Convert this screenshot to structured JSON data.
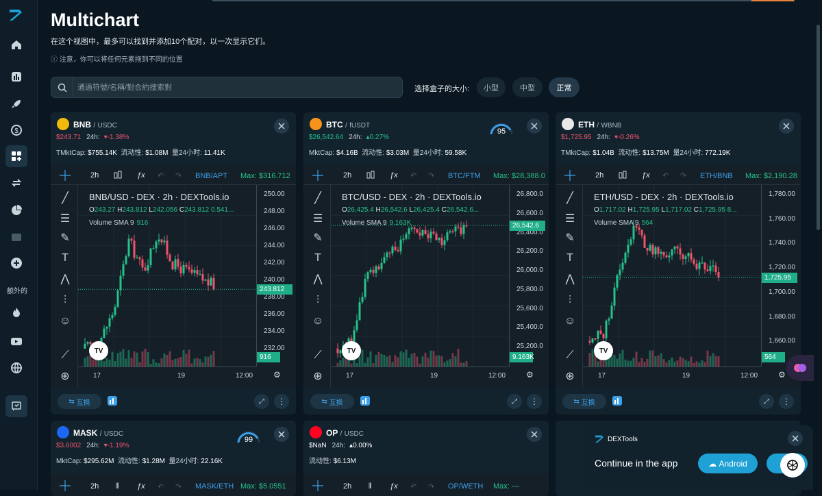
{
  "page": {
    "title": "Multichart",
    "subtitle": "在这个视图中，最多可以找到并添加10个配对，以一次显示它们。",
    "note": "注意，你可以将任何元素拖到不同的位置"
  },
  "sidebar": {
    "extra_label": "额外的",
    "items": [
      "home-icon",
      "chart-icon",
      "rocket-icon",
      "dollar-icon",
      "multichart-icon",
      "swap-icon",
      "pie-icon",
      "wallet-icon",
      "plus-icon",
      "fire-icon",
      "youtube-icon",
      "globe-icon",
      "feedback-icon"
    ]
  },
  "search": {
    "placeholder": "通過符號/名稱/對合約搜索對"
  },
  "size": {
    "label": "选择盒子的大小:",
    "options": [
      "小型",
      "中型",
      "正常"
    ],
    "selected": "正常"
  },
  "colors": {
    "up": "#25c28a",
    "down": "#f0546c",
    "accent": "#3da0e8",
    "bg": "#0b1720"
  },
  "common": {
    "interval": "2h",
    "swap_label": "互换",
    "x_ticks": [
      "17",
      "19",
      "12:00"
    ],
    "vol_label": "Volume SMA 9"
  },
  "panels": [
    {
      "sym": "BNB",
      "quote": "USDC",
      "price": "$243.71",
      "lbl24": "24h:",
      "change": "-1.38%",
      "dir": "down",
      "stats": [
        [
          "TMktCap:",
          "$755.14K"
        ],
        [
          "流动性:",
          "$1.08M"
        ],
        [
          "量24小时:",
          "11.41K"
        ]
      ],
      "pair_tag": "BNB/APT",
      "max": "Max: $316.712",
      "tv_title": "BNB/USD - DEX · 2h · DEXTools.io",
      "ohlc": {
        "o": "243.27",
        "h": "243.812",
        "l": "242.056",
        "c": "243.812 0.541..."
      },
      "vol": "916",
      "axis_ticks": [
        "250.00",
        "248.00",
        "246.00",
        "244.00",
        "242.00",
        "240.00",
        "238.00",
        "236.00",
        "234.00",
        "232.00"
      ],
      "price_tag": "243.812",
      "vol_tag": "916",
      "gauge": "",
      "icon_color": "#f0b90b"
    },
    {
      "sym": "BTC",
      "quote": "fUSDT",
      "price": "$26,542.64",
      "lbl24": "24h:",
      "change": "0.27%",
      "dir": "up",
      "stats": [
        [
          "MktCap:",
          "$4.16B"
        ],
        [
          "流动性:",
          "$3.03M"
        ],
        [
          "量24小时:",
          "59.58K"
        ]
      ],
      "pair_tag": "BTC/FTM",
      "max": "Max: $28,388.0",
      "tv_title": "BTC/USD - DEX · 2h · DEXTools.io",
      "ohlc": {
        "o": "26,425.4",
        "h": "26,542.6",
        "l": "26,425.4",
        "c": "26,542.6..."
      },
      "vol": "9.163K",
      "axis_ticks": [
        "26,800.0",
        "26,600.0",
        "26,400.0",
        "26,200.0",
        "26,000.0",
        "25,800.0",
        "25,600.0",
        "25,400.0",
        "25,200.0"
      ],
      "price_tag": "26,542.6",
      "vol_tag": "9.163K",
      "gauge": "95",
      "icon_color": "#f7931a"
    },
    {
      "sym": "ETH",
      "quote": "WBNB",
      "price": "$1,725.95",
      "lbl24": "24h:",
      "change": "-0.26%",
      "dir": "down",
      "stats": [
        [
          "TMktCap:",
          "$1.04B"
        ],
        [
          "流动性:",
          "$13.75M"
        ],
        [
          "量24小时:",
          "772.19K"
        ]
      ],
      "pair_tag": "ETH/BNB",
      "max": "Max: $2,190.28",
      "tv_title": "ETH/USD - DEX · 2h · DEXTools.io",
      "ohlc": {
        "o": "1,717.02",
        "h": "1,725.95",
        "l": "1,717.02",
        "c": "1,725.95 8..."
      },
      "vol": "564",
      "axis_ticks": [
        "1,780.00",
        "1,760.00",
        "1,740.00",
        "1,720.00",
        "1,700.00",
        "1,680.00",
        "1,660.00"
      ],
      "price_tag": "1,725.95",
      "vol_tag": "564",
      "gauge": "",
      "icon_color": "#e8e8e8"
    }
  ],
  "panels2": [
    {
      "sym": "MASK",
      "quote": "USDC",
      "price": "$3.6002",
      "lbl24": "24h:",
      "change": "-1.19%",
      "dir": "down",
      "stats": [
        [
          "MktCap:",
          "$295.62M"
        ],
        [
          "流动性:",
          "$1.28M"
        ],
        [
          "量24小时:",
          "22.16K"
        ]
      ],
      "pair_tag": "MASK/ETH",
      "max": "Max: $5.0551",
      "gauge": "99",
      "icon_color": "#1c68f3"
    },
    {
      "sym": "OP",
      "quote": "USDC",
      "price": "$NaN",
      "lbl24": "24h:",
      "change": "0.00%",
      "dir": "flat",
      "stats": [
        [
          "流动性:",
          "$6.13M"
        ]
      ],
      "pair_tag": "OP/WETH",
      "max": "Max: ---",
      "gauge": "",
      "icon_color": "#ff0420"
    }
  ],
  "promo": {
    "brand": "DEXTools",
    "text": "Continue in the app",
    "android": "Android"
  }
}
